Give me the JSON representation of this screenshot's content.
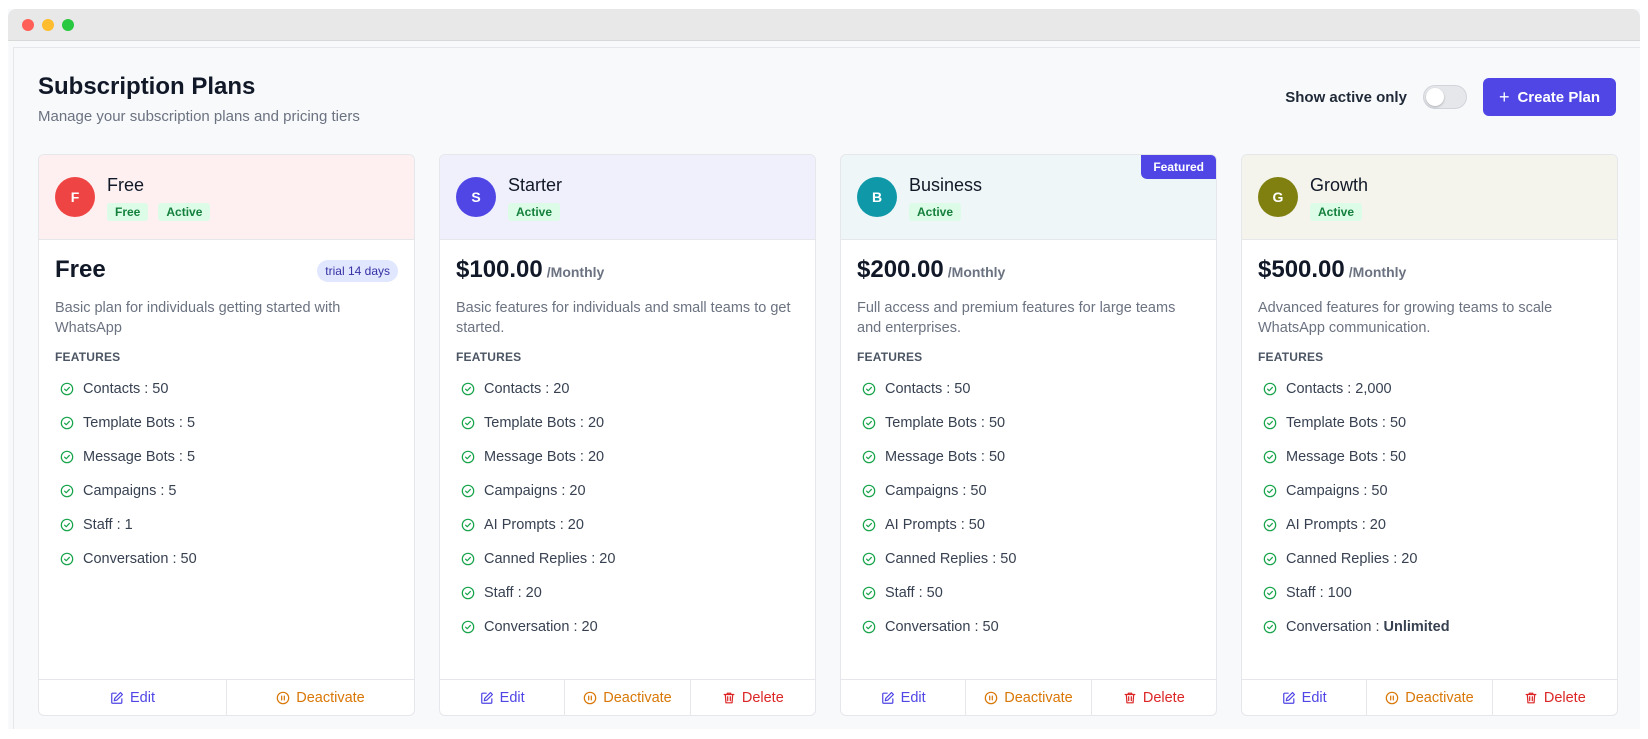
{
  "header": {
    "title": "Subscription Plans",
    "subtitle": "Manage your subscription plans and pricing tiers",
    "toggle_label": "Show active only",
    "create_label": "Create Plan"
  },
  "colors": {
    "primary": "#4f46e5",
    "success": "#16a34a",
    "warning": "#d97706",
    "danger": "#dc2626"
  },
  "plans": [
    {
      "initial": "F",
      "name": "Free",
      "avatar_color": "#ef4444",
      "head_bg": "#fef0f0",
      "badges": [
        "Free",
        "Active"
      ],
      "featured": "",
      "price": "Free",
      "period": "",
      "trial": "trial 14 days",
      "description": "Basic plan for individuals getting started with WhatsApp",
      "features_label": "FEATURES",
      "features": [
        {
          "name": "Contacts :",
          "value": "50"
        },
        {
          "name": "Template Bots :",
          "value": "5"
        },
        {
          "name": "Message Bots :",
          "value": "5"
        },
        {
          "name": "Campaigns :",
          "value": "5"
        },
        {
          "name": "Staff :",
          "value": "1"
        },
        {
          "name": "Conversation :",
          "value": "50"
        }
      ],
      "actions": {
        "edit": "Edit",
        "deactivate": "Deactivate",
        "delete": ""
      }
    },
    {
      "initial": "S",
      "name": "Starter",
      "avatar_color": "#4f46e5",
      "head_bg": "#f0f0fd",
      "badges": [
        "Active"
      ],
      "featured": "",
      "price": "$100.00",
      "period": "/Monthly",
      "trial": "",
      "description": "Basic features for individuals and small teams to get started.",
      "features_label": "FEATURES",
      "features": [
        {
          "name": "Contacts :",
          "value": "20"
        },
        {
          "name": "Template Bots :",
          "value": "20"
        },
        {
          "name": "Message Bots :",
          "value": "20"
        },
        {
          "name": "Campaigns :",
          "value": "20"
        },
        {
          "name": "AI Prompts :",
          "value": "20"
        },
        {
          "name": "Canned Replies :",
          "value": "20"
        },
        {
          "name": "Staff :",
          "value": "20"
        },
        {
          "name": "Conversation :",
          "value": "20"
        }
      ],
      "actions": {
        "edit": "Edit",
        "deactivate": "Deactivate",
        "delete": "Delete"
      }
    },
    {
      "initial": "B",
      "name": "Business",
      "avatar_color": "#0e98a8",
      "head_bg": "#eef6f8",
      "badges": [
        "Active"
      ],
      "featured": "Featured",
      "price": "$200.00",
      "period": "/Monthly",
      "trial": "",
      "description": "Full access and premium features for large teams and enterprises.",
      "features_label": "FEATURES",
      "features": [
        {
          "name": "Contacts :",
          "value": "50"
        },
        {
          "name": "Template Bots :",
          "value": "50"
        },
        {
          "name": "Message Bots :",
          "value": "50"
        },
        {
          "name": "Campaigns :",
          "value": "50"
        },
        {
          "name": "AI Prompts :",
          "value": "50"
        },
        {
          "name": "Canned Replies :",
          "value": "50"
        },
        {
          "name": "Staff :",
          "value": "50"
        },
        {
          "name": "Conversation :",
          "value": "50"
        }
      ],
      "actions": {
        "edit": "Edit",
        "deactivate": "Deactivate",
        "delete": "Delete"
      }
    },
    {
      "initial": "G",
      "name": "Growth",
      "avatar_color": "#808010",
      "head_bg": "#f4f4ed",
      "badges": [
        "Active"
      ],
      "featured": "",
      "price": "$500.00",
      "period": "/Monthly",
      "trial": "",
      "description": "Advanced features for growing teams to scale WhatsApp communication.",
      "features_label": "FEATURES",
      "features": [
        {
          "name": "Contacts :",
          "value": "2,000"
        },
        {
          "name": "Template Bots :",
          "value": "50"
        },
        {
          "name": "Message Bots :",
          "value": "50"
        },
        {
          "name": "Campaigns :",
          "value": "50"
        },
        {
          "name": "AI Prompts :",
          "value": "20"
        },
        {
          "name": "Canned Replies :",
          "value": "20"
        },
        {
          "name": "Staff :",
          "value": "100"
        },
        {
          "name": "Conversation :",
          "value": "Unlimited",
          "bold": true
        }
      ],
      "actions": {
        "edit": "Edit",
        "deactivate": "Deactivate",
        "delete": "Delete"
      }
    }
  ]
}
